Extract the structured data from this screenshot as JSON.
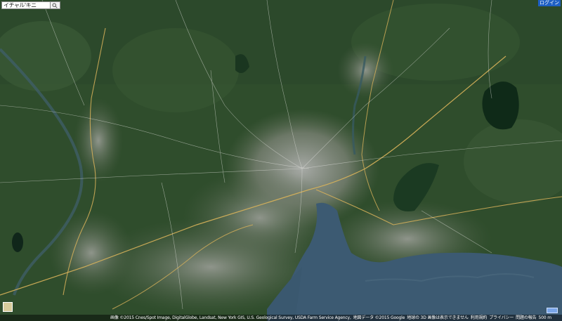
{
  "search": {
    "value": "イチャル'キニ"
  },
  "header": {
    "login_label": "ログイン"
  },
  "map": {
    "type": "satellite",
    "colors": {
      "forest": "#2f4d2c",
      "urban": "#8b8f88",
      "water": "#3c5a72",
      "roads": "#d8b25a"
    }
  },
  "footer": {
    "imagery": "画像 ©2015 Cnes/Spot Image, DigitalGlobe, Landsat, New York GIS, U.S. Geological Survey, USDA Farm Service Agency,",
    "map_data": "地図データ ©2015 Google",
    "notice": "地球の 3D 画像は表示できません",
    "terms": "利用規約",
    "privacy": "プライバシー",
    "report": "問題の報告",
    "scale": "500 m"
  }
}
